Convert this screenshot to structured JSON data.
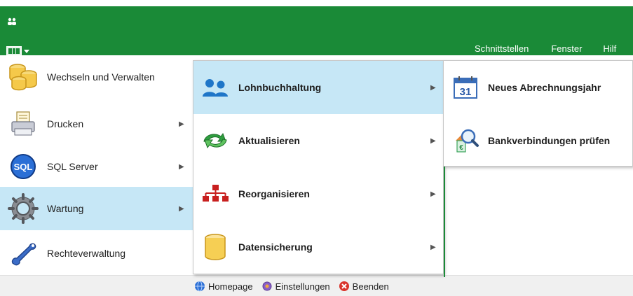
{
  "top_menu": {
    "items": [
      {
        "label": "Schnittstellen"
      },
      {
        "label": "Fenster"
      },
      {
        "label": "Hilf"
      }
    ]
  },
  "left_menu": {
    "items": [
      {
        "label": "Wechseln und Verwalten",
        "icon": "database-icon",
        "has_submenu": false,
        "active": false
      },
      {
        "label": "Drucken",
        "icon": "printer-icon",
        "has_submenu": true,
        "active": false
      },
      {
        "label": "SQL Server",
        "icon": "sql-server-icon",
        "has_submenu": true,
        "active": false
      },
      {
        "label": "Wartung",
        "icon": "gear-icon",
        "has_submenu": true,
        "active": true
      },
      {
        "label": "Rechteverwaltung",
        "icon": "key-icon",
        "has_submenu": false,
        "active": false
      }
    ]
  },
  "submenu": {
    "items": [
      {
        "label": "Lohnbuchhaltung",
        "icon": "users-icon",
        "active": true
      },
      {
        "label": "Aktualisieren",
        "icon": "refresh-arrows-icon",
        "active": false
      },
      {
        "label": "Reorganisieren",
        "icon": "org-chart-icon",
        "active": false
      },
      {
        "label": "Datensicherung",
        "icon": "database-backup-icon",
        "active": false
      }
    ]
  },
  "submenu2": {
    "items": [
      {
        "label": "Neues Abrechnungsjahr",
        "icon": "calendar-icon",
        "calendar_day": "31"
      },
      {
        "label": "Bankverbindungen prüfen",
        "icon": "bank-search-icon"
      }
    ]
  },
  "footer": {
    "homepage": "Homepage",
    "settings": "Einstellungen",
    "exit": "Beenden"
  },
  "colors": {
    "title_green": "#1a8a37",
    "highlight_blue": "#c6e7f6"
  }
}
